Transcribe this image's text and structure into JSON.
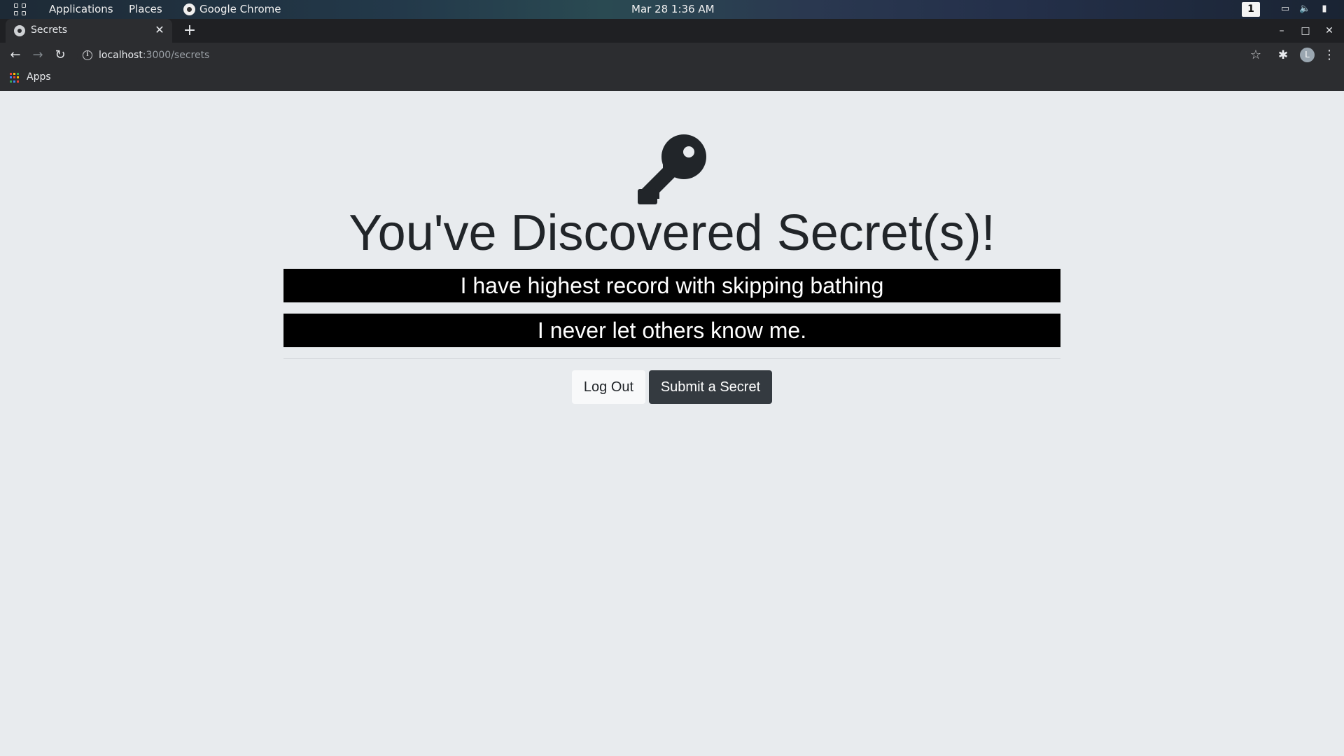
{
  "os_topbar": {
    "applications": "Applications",
    "places": "Places",
    "active_app": "Google Chrome",
    "datetime": "Mar 28  1:36 AM",
    "workspace": "1"
  },
  "browser": {
    "tab_title": "Secrets",
    "url_host": "localhost",
    "url_path": ":3000/secrets",
    "profile_initial": "L",
    "bookmarks": {
      "apps_label": "Apps"
    }
  },
  "page": {
    "heading": "You've Discovered Secret(s)!",
    "secrets": [
      "I have highest record with skipping bathing",
      "I never let others know me."
    ],
    "buttons": {
      "logout": "Log Out",
      "submit": "Submit a Secret"
    }
  },
  "colors": {
    "page_background": "#e8ebee",
    "secret_background": "#000000",
    "secret_text": "#ffffff",
    "heading_text": "#212529",
    "logout_button_bg": "#f8f9fa",
    "submit_button_bg": "#343a40"
  }
}
